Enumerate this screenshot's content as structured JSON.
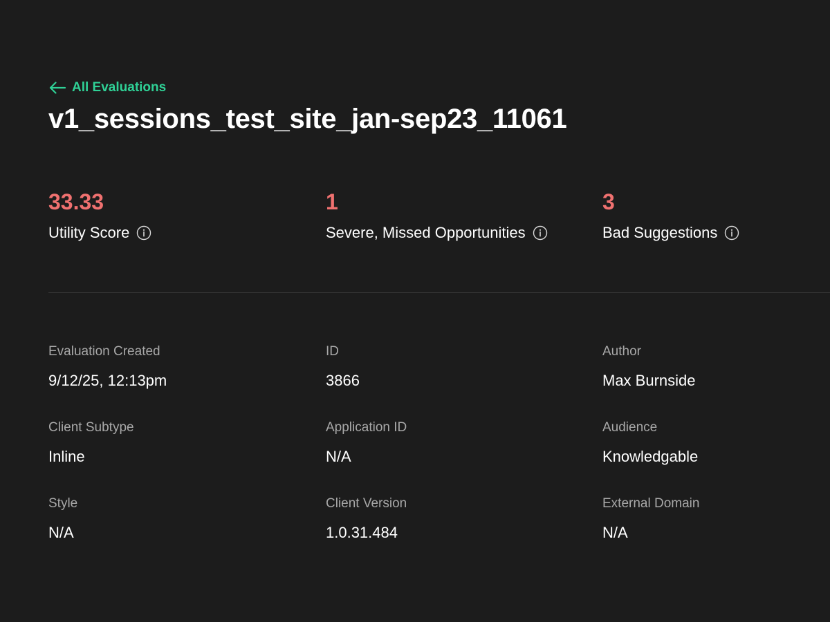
{
  "nav": {
    "back_label": "All Evaluations"
  },
  "header": {
    "title": "v1_sessions_test_site_jan-sep23_11061"
  },
  "metrics": [
    {
      "value": "33.33",
      "label": "Utility Score"
    },
    {
      "value": "1",
      "label": "Severe, Missed Opportunities"
    },
    {
      "value": "3",
      "label": "Bad Suggestions"
    }
  ],
  "details": {
    "evaluation_created": {
      "label": "Evaluation Created",
      "value": "9/12/25, 12:13pm"
    },
    "id": {
      "label": "ID",
      "value": "3866"
    },
    "author": {
      "label": "Author",
      "value": "Max Burnside"
    },
    "client_subtype": {
      "label": "Client Subtype",
      "value": "Inline"
    },
    "application_id": {
      "label": "Application ID",
      "value": "N/A"
    },
    "audience": {
      "label": "Audience",
      "value": "Knowledgable"
    },
    "style": {
      "label": "Style",
      "value": "N/A"
    },
    "client_version": {
      "label": "Client Version",
      "value": "1.0.31.484"
    },
    "external_domain": {
      "label": "External Domain",
      "value": "N/A"
    }
  },
  "icons": {
    "back": "arrow-left-icon",
    "info": "info-icon"
  },
  "colors": {
    "background": "#1c1c1c",
    "accent": "#2fd196",
    "metric_value": "#f07170",
    "label_muted": "#a8a8a8",
    "divider": "#383838"
  }
}
